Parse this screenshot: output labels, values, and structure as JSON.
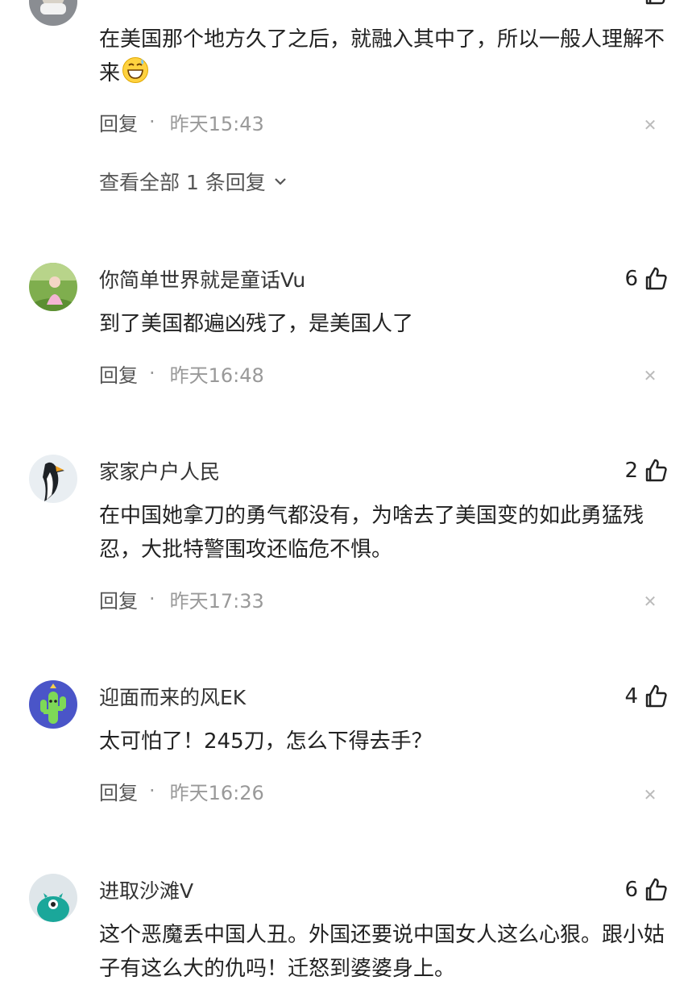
{
  "comments": [
    {
      "text": "在美国那个地方久了之后，就融入其中了，所以一般人理解不来",
      "emoji": "grinning-sweat-emoji",
      "reply_label": "回复",
      "time": "昨天15:43",
      "view_all_replies": "查看全部 1 条回复"
    },
    {
      "username": "你简单世界就是童话Vu",
      "likes": "6",
      "text": "到了美国都遍凶残了，是美国人了",
      "reply_label": "回复",
      "time": "昨天16:48"
    },
    {
      "username": "家家户户人民",
      "likes": "2",
      "text": "在中国她拿刀的勇气都没有，为啥去了美国变的如此勇猛残忍，大批特警围攻还临危不惧。",
      "reply_label": "回复",
      "time": "昨天17:33"
    },
    {
      "username": "迎面而来的风EK",
      "likes": "4",
      "text": "太可怕了！245刀，怎么下得去手？",
      "reply_label": "回复",
      "time": "昨天16:26"
    },
    {
      "username": "进取沙滩V",
      "likes": "6",
      "text": "这个恶魔丢中国人丑。外国还要说中国女人这么心狠。跟小姑子有这么大的仇吗！迁怒到婆婆身上。"
    }
  ],
  "icons": {
    "like": "thumbs-up-icon",
    "close": "close-icon",
    "expand": "chevron-down-icon"
  },
  "colors": {
    "text_primary": "#222222",
    "text_secondary": "#999999",
    "background": "#ffffff"
  }
}
